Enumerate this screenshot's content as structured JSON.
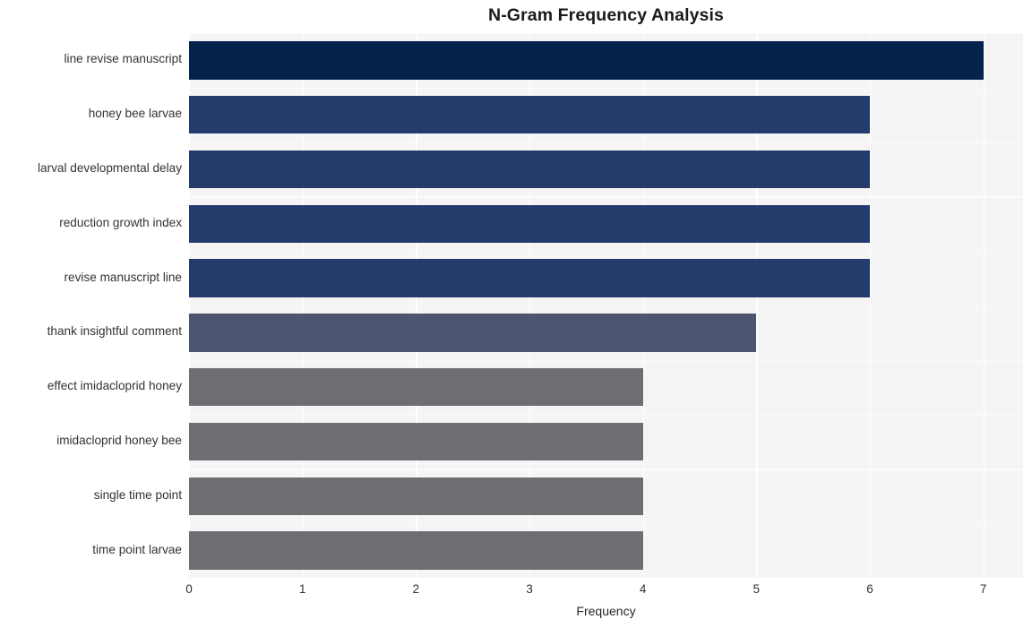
{
  "chart_data": {
    "type": "bar",
    "orientation": "horizontal",
    "title": "N-Gram Frequency Analysis",
    "xlabel": "Frequency",
    "ylabel": "",
    "categories": [
      "line revise manuscript",
      "honey bee larvae",
      "larval developmental delay",
      "reduction growth index",
      "revise manuscript line",
      "thank insightful comment",
      "effect imidacloprid honey",
      "imidacloprid honey bee",
      "single time point",
      "time point larvae"
    ],
    "values": [
      7,
      6,
      6,
      6,
      6,
      5,
      4,
      4,
      4,
      4
    ],
    "bar_colors": [
      "#03234b",
      "#243b6b",
      "#243b6b",
      "#243b6b",
      "#243b6b",
      "#4d5470",
      "#6c6e72",
      "#6c6e72",
      "#6c6e72",
      "#6c6e72"
    ],
    "xlim": [
      0,
      7.35
    ],
    "xticks": [
      0,
      1,
      2,
      3,
      4,
      5,
      6,
      7
    ],
    "xtick_labels": [
      "0",
      "1",
      "2",
      "3",
      "4",
      "5",
      "6",
      "7"
    ],
    "grid": true,
    "grid_color": "#ffffff",
    "plot_background": "#f5f5f6",
    "figure_background": "#ffffff",
    "legend": null
  }
}
